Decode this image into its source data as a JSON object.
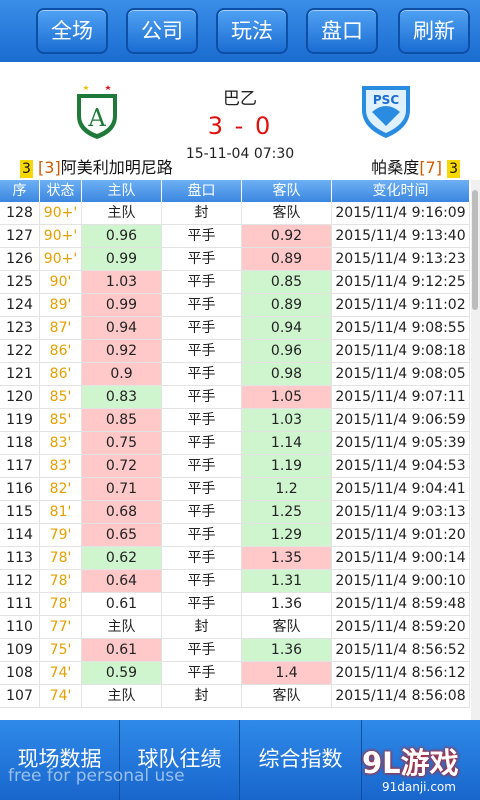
{
  "top_nav": [
    "全场",
    "公司",
    "玩法",
    "盘口",
    "刷新"
  ],
  "match": {
    "league": "巴乙",
    "score": "3 - 0",
    "time": "15-11-04 07:30",
    "home": {
      "pos": "3",
      "rank": "[3]",
      "name": "阿美利加明尼路"
    },
    "away": {
      "name": "帕桑度",
      "rank": "[7]",
      "pos": "3"
    }
  },
  "table": {
    "headers": [
      "序",
      "状态",
      "主队",
      "盘口",
      "客队",
      "变化时间"
    ],
    "rows": [
      [
        "128",
        "90+'",
        "主队",
        "封",
        "客队",
        "2015/11/4 9:16:09",
        "",
        ""
      ],
      [
        "127",
        "90+'",
        "0.96",
        "平手",
        "0.92",
        "2015/11/4 9:13:40",
        "dn",
        "up"
      ],
      [
        "126",
        "90+'",
        "0.99",
        "平手",
        "0.89",
        "2015/11/4 9:13:23",
        "dn",
        "up"
      ],
      [
        "125",
        "90'",
        "1.03",
        "平手",
        "0.85",
        "2015/11/4 9:12:25",
        "up",
        "dn"
      ],
      [
        "124",
        "89'",
        "0.99",
        "平手",
        "0.89",
        "2015/11/4 9:11:02",
        "up",
        "dn"
      ],
      [
        "123",
        "87'",
        "0.94",
        "平手",
        "0.94",
        "2015/11/4 9:08:55",
        "up",
        "dn"
      ],
      [
        "122",
        "86'",
        "0.92",
        "平手",
        "0.96",
        "2015/11/4 9:08:18",
        "up",
        "dn"
      ],
      [
        "121",
        "86'",
        "0.9",
        "平手",
        "0.98",
        "2015/11/4 9:08:05",
        "up",
        "dn"
      ],
      [
        "120",
        "85'",
        "0.83",
        "平手",
        "1.05",
        "2015/11/4 9:07:11",
        "dn",
        "up"
      ],
      [
        "119",
        "85'",
        "0.85",
        "平手",
        "1.03",
        "2015/11/4 9:06:59",
        "up",
        "dn"
      ],
      [
        "118",
        "83'",
        "0.75",
        "平手",
        "1.14",
        "2015/11/4 9:05:39",
        "up",
        "dn"
      ],
      [
        "117",
        "83'",
        "0.72",
        "平手",
        "1.19",
        "2015/11/4 9:04:53",
        "up",
        "dn"
      ],
      [
        "116",
        "82'",
        "0.71",
        "平手",
        "1.2",
        "2015/11/4 9:04:41",
        "up",
        "dn"
      ],
      [
        "115",
        "81'",
        "0.68",
        "平手",
        "1.25",
        "2015/11/4 9:03:13",
        "up",
        "dn"
      ],
      [
        "114",
        "79'",
        "0.65",
        "平手",
        "1.29",
        "2015/11/4 9:01:20",
        "up",
        "dn"
      ],
      [
        "113",
        "78'",
        "0.62",
        "平手",
        "1.35",
        "2015/11/4 9:00:14",
        "dn",
        "up"
      ],
      [
        "112",
        "78'",
        "0.64",
        "平手",
        "1.31",
        "2015/11/4 9:00:10",
        "up",
        "dn"
      ],
      [
        "111",
        "78'",
        "0.61",
        "平手",
        "1.36",
        "2015/11/4 8:59:48",
        "",
        ""
      ],
      [
        "110",
        "77'",
        "主队",
        "封",
        "客队",
        "2015/11/4 8:59:20",
        "",
        ""
      ],
      [
        "109",
        "75'",
        "0.61",
        "平手",
        "1.36",
        "2015/11/4 8:56:52",
        "up",
        "dn"
      ],
      [
        "108",
        "74'",
        "0.59",
        "平手",
        "1.4",
        "2015/11/4 8:56:12",
        "dn",
        "up"
      ],
      [
        "107",
        "74'",
        "主队",
        "封",
        "客队",
        "2015/11/4 8:56:08",
        "",
        ""
      ]
    ]
  },
  "bottom_nav": [
    "现场数据",
    "球队往绩",
    "综合指数"
  ],
  "watermark": "free for personal use",
  "brand": {
    "main": "9L游戏",
    "sub": "91danji.com"
  },
  "colors": {
    "blue": "#1a6cd0",
    "up": "#ffc9c9",
    "down": "#cff5cf",
    "score": "#e01010",
    "status": "#e3a000"
  }
}
